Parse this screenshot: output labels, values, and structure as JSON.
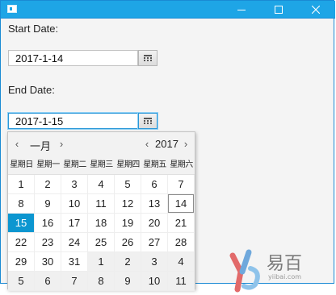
{
  "window": {
    "controls": {
      "minimize": "minimize",
      "maximize": "maximize",
      "close": "close"
    }
  },
  "form": {
    "start_label": "Start Date:",
    "start_value": "2017-1-14",
    "end_label": "End Date:",
    "end_value": "2017-1-15"
  },
  "calendar": {
    "month_label": "一月",
    "year_label": "2017",
    "prev_month": "‹",
    "next_month": "›",
    "prev_year": "‹",
    "next_year": "›",
    "weekdays": [
      "星期日",
      "星期一",
      "星期二",
      "星期三",
      "星期四",
      "星期五",
      "星期六"
    ],
    "weeks": [
      [
        {
          "d": "1"
        },
        {
          "d": "2"
        },
        {
          "d": "3"
        },
        {
          "d": "4"
        },
        {
          "d": "5"
        },
        {
          "d": "6"
        },
        {
          "d": "7"
        }
      ],
      [
        {
          "d": "8"
        },
        {
          "d": "9"
        },
        {
          "d": "10"
        },
        {
          "d": "11"
        },
        {
          "d": "12"
        },
        {
          "d": "13"
        },
        {
          "d": "14",
          "today": true
        }
      ],
      [
        {
          "d": "15",
          "selected": true
        },
        {
          "d": "16"
        },
        {
          "d": "17"
        },
        {
          "d": "18"
        },
        {
          "d": "19"
        },
        {
          "d": "20"
        },
        {
          "d": "21"
        }
      ],
      [
        {
          "d": "22"
        },
        {
          "d": "23"
        },
        {
          "d": "24"
        },
        {
          "d": "25"
        },
        {
          "d": "26"
        },
        {
          "d": "27"
        },
        {
          "d": "28"
        }
      ],
      [
        {
          "d": "29"
        },
        {
          "d": "30"
        },
        {
          "d": "31"
        },
        {
          "d": "1",
          "other": true
        },
        {
          "d": "2",
          "other": true
        },
        {
          "d": "3",
          "other": true
        },
        {
          "d": "4",
          "other": true
        }
      ],
      [
        {
          "d": "5",
          "other": true
        },
        {
          "d": "6",
          "other": true
        },
        {
          "d": "7",
          "other": true
        },
        {
          "d": "8",
          "other": true
        },
        {
          "d": "9",
          "other": true
        },
        {
          "d": "10",
          "other": true
        },
        {
          "d": "11",
          "other": true
        }
      ]
    ]
  },
  "watermark": {
    "name": "易百",
    "domain": "yiibai.com"
  },
  "colors": {
    "titlebar": "#1ea5e6",
    "selected_day": "#0c96d0",
    "focus_border": "#2a97d8"
  },
  "icons": {
    "app": "app-window-icon",
    "calendar": "calendar-icon",
    "minimize": "minimize-icon",
    "maximize": "maximize-icon",
    "close": "close-icon"
  }
}
